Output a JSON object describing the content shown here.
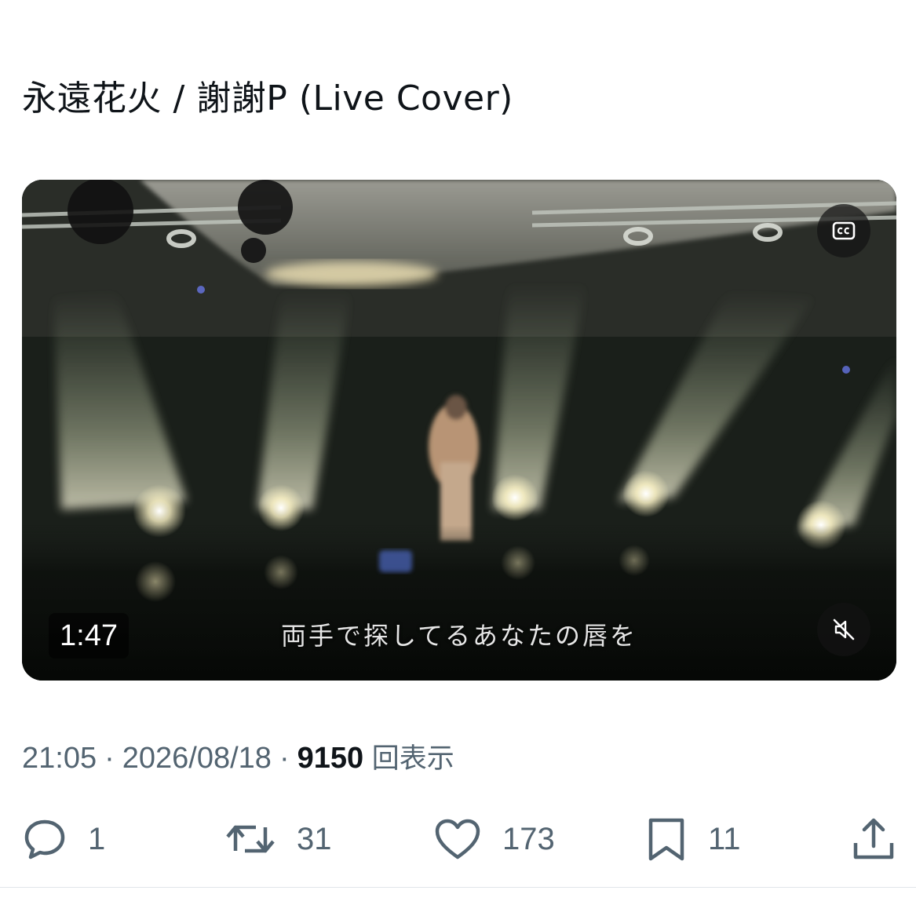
{
  "tweet": {
    "text": "永遠花火 / 謝謝P (Live Cover)"
  },
  "video": {
    "duration": "1:47",
    "subtitle": "両手で探してるあなたの唇を",
    "cc_icon": "closed-captions-icon",
    "mute_icon": "muted-speaker-icon"
  },
  "meta": {
    "time": "21:05",
    "separator": "·",
    "date": "2026/08/18",
    "views_count": "9150",
    "views_label": "回表示"
  },
  "actions": {
    "replies": "1",
    "reposts": "31",
    "likes": "173",
    "bookmarks": "11"
  },
  "colors": {
    "text_primary": "#0f1419",
    "text_secondary": "#536471",
    "background": "#ffffff"
  }
}
